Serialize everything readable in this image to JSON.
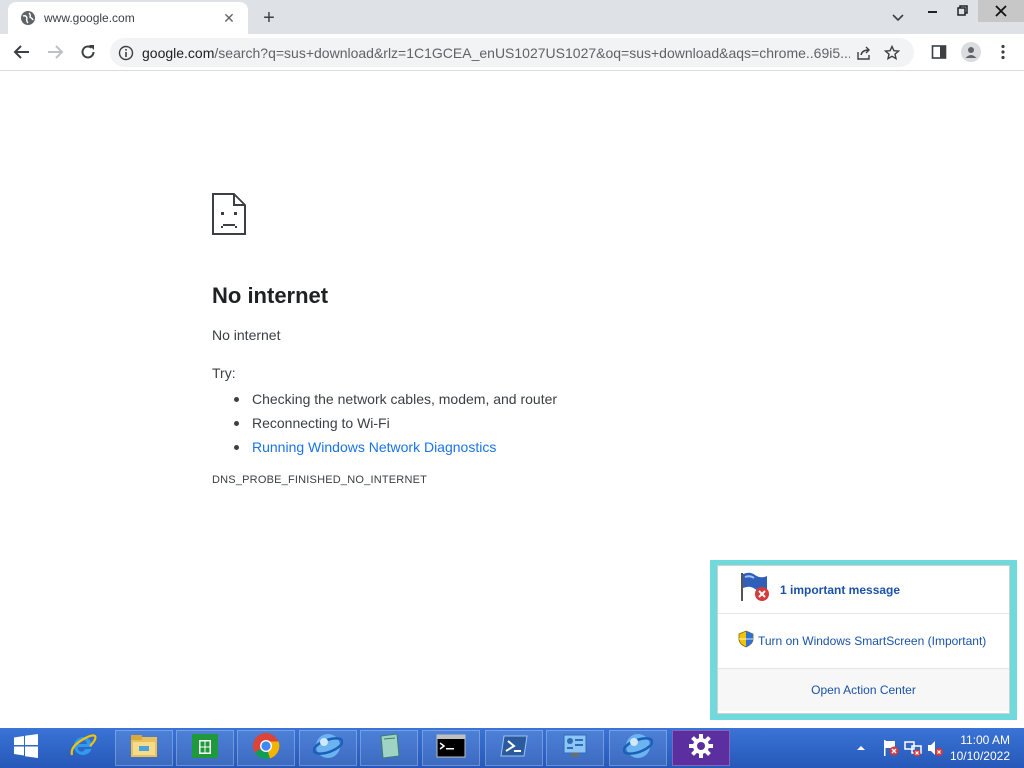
{
  "browser": {
    "tab": {
      "title": "www.google.com",
      "favicon": "globe-icon"
    },
    "omnibox": {
      "host": "google.com",
      "path": "/search?q=sus+download&rlz=1C1GCEA_enUS1027US1027&oq=sus+download&aqs=chrome..69i5..."
    }
  },
  "error_page": {
    "title": "No internet",
    "subtitle": "No internet",
    "try_label": "Try:",
    "suggestions": [
      "Checking the network cables, modem, and router",
      "Reconnecting to Wi-Fi",
      "Running Windows Network Diagnostics"
    ],
    "error_code": "DNS_PROBE_FINISHED_NO_INTERNET",
    "link_color": "#1a73e8"
  },
  "action_center": {
    "important_message": "1 important message",
    "smartscreen": "Turn on Windows SmartScreen (Important)",
    "open_label": "Open Action Center",
    "border_color": "#6fd9dc"
  },
  "taskbar": {
    "apps": [
      "internet-explorer",
      "file-explorer",
      "store",
      "chrome",
      "app-blue-orb",
      "app-tablet",
      "command-prompt",
      "powershell",
      "control-panel",
      "app-blue-orb-2",
      "settings"
    ],
    "clock": {
      "time": "11:00 AM",
      "date": "10/10/2022"
    }
  }
}
